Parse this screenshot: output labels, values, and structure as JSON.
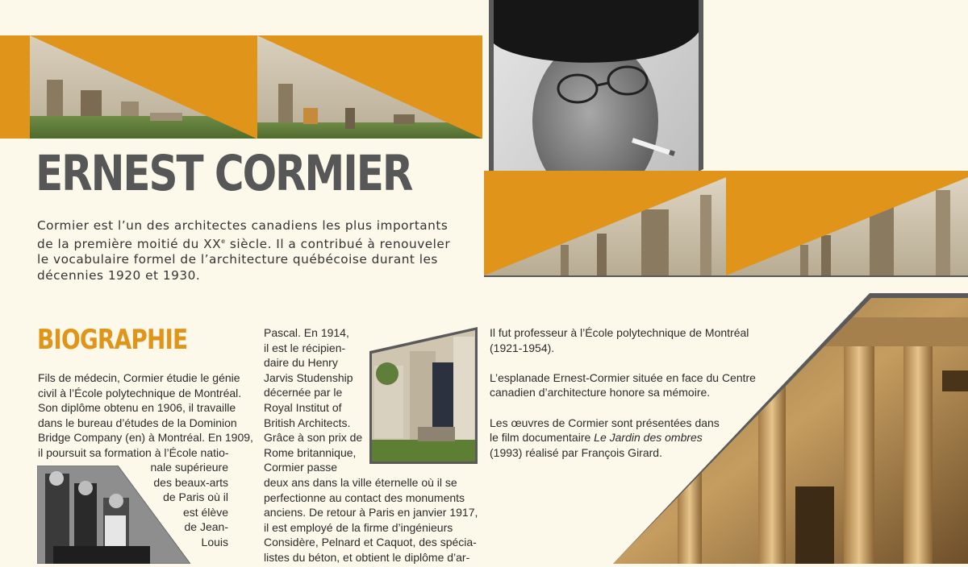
{
  "colors": {
    "accent": "#e0951a",
    "background": "#fcf8ea",
    "title": "#575757",
    "frame": "#5a5a5a"
  },
  "header": {
    "title": "ERNEST CORMIER",
    "intro_line1": "Cormier est l’un des architectes canadiens les plus importants",
    "intro_line2a": "de la première moitié du XX",
    "intro_sup": "e",
    "intro_line2b": " siècle. Il a contribué à renouveler",
    "intro_line3": "le vocabulaire formel de l’architecture québécoise durant les",
    "intro_line4": "décennies 1920 et 1930."
  },
  "biography": {
    "heading": "BIOGRAPHIE",
    "col1_lines": [
      "Fils de médecin, Cormier étudie le génie",
      "civil à l’École polytechnique de Montréal.",
      "Son diplôme obtenu en 1906, il travaille",
      "dans le bureau d’études de la Dominion",
      "Bridge Company (en) à Montréal. En 1909,",
      "il poursuit sa formation à l’École natio-"
    ],
    "col1_wrap_lines": [
      "nale supérieure",
      "des beaux-arts",
      "de Paris où il",
      "est élève",
      "de Jean-",
      "Louis"
    ],
    "col2_top_lines": [
      "Pascal. En 1914,",
      "il est le récipien-",
      "daire du Henry",
      "Jarvis Studenship",
      "décernée par le",
      "Royal Institut of",
      "British Architects.",
      "Grâce à son prix de",
      "Rome britannique,",
      "Cormier passe"
    ],
    "col2_bottom_lines": [
      "deux ans dans la ville éternelle où il se",
      "perfectionne au contact des monuments",
      "anciens. De retour à Paris en janvier 1917,",
      "il est employé de la firme d’ingénieurs",
      "Considère, Pelnard et Caquot, des spécia-",
      "listes du béton, et obtient le diplôme d’ar-"
    ],
    "col3": {
      "p1_line1": "Il fut professeur à l’École polytechnique de Montréal",
      "p1_line2": "(1921-1954).",
      "p2_line1": "L’esplanade Ernest-Cormier située en face du Centre",
      "p2_line2": "canadien d’architecture honore sa mémoire.",
      "p3_line1": "Les œuvres de Cormier sont présentées dans",
      "p3_line2a": "le film documentaire ",
      "p3_film": "Le Jardin des ombres",
      "p3_line3": "(1993) réalisé par François Girard."
    }
  }
}
